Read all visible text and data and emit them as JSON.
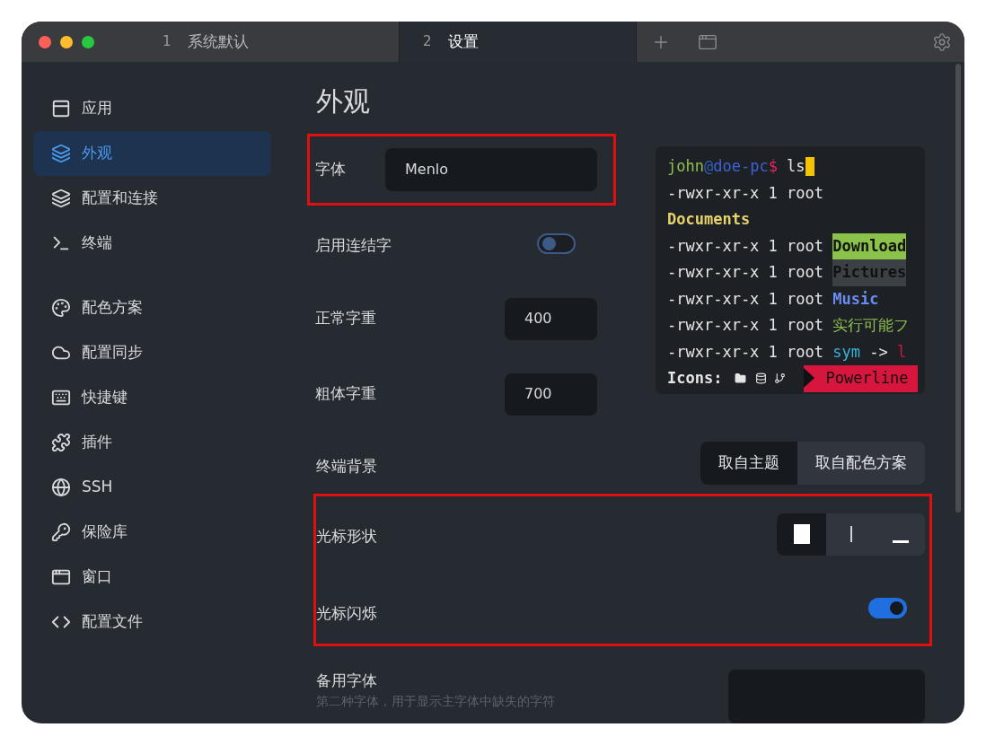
{
  "tabs": [
    {
      "number": "1",
      "label": "系统默认",
      "selected": false
    },
    {
      "number": "2",
      "label": "设置",
      "selected": true
    }
  ],
  "sidebar": {
    "items": [
      {
        "label": "应用",
        "selected": false,
        "kind": "app"
      },
      {
        "label": "外观",
        "selected": true,
        "kind": "appearance"
      },
      {
        "label": "配置和连接",
        "selected": false,
        "kind": "profiles"
      },
      {
        "label": "终端",
        "selected": false,
        "kind": "terminal"
      },
      {
        "label": "配色方案",
        "selected": false,
        "kind": "colors"
      },
      {
        "label": "配置同步",
        "selected": false,
        "kind": "sync"
      },
      {
        "label": "快捷键",
        "selected": false,
        "kind": "hotkeys"
      },
      {
        "label": "插件",
        "selected": false,
        "kind": "plugins"
      },
      {
        "label": "SSH",
        "selected": false,
        "kind": "ssh"
      },
      {
        "label": "保险库",
        "selected": false,
        "kind": "vault"
      },
      {
        "label": "窗口",
        "selected": false,
        "kind": "window"
      },
      {
        "label": "配置文件",
        "selected": false,
        "kind": "config"
      }
    ]
  },
  "page_title": "外观",
  "font": {
    "label": "字体",
    "value": "Menlo",
    "highlighted": true
  },
  "ligatures": {
    "label": "启用连结字",
    "on": false
  },
  "normal_weight": {
    "label": "正常字重",
    "value": "400"
  },
  "bold_weight": {
    "label": "粗体字重",
    "value": "700"
  },
  "terminal_preview": {
    "lines": [
      [
        {
          "text": "john",
          "kind": "user"
        },
        {
          "text": "@",
          "kind": "at"
        },
        {
          "text": "doe-pc",
          "kind": "host"
        },
        {
          "text": "$",
          "kind": "prompt"
        },
        {
          "text": " ls",
          "kind": "plain"
        }
      ],
      [
        {
          "text": "-rwxr-xr-x 1 root",
          "kind": "plain"
        }
      ],
      [
        {
          "text": "Documents",
          "kind": "directory"
        }
      ],
      [
        {
          "text": "-rwxr-xr-x 1 root ",
          "kind": "plain"
        },
        {
          "text": "Download",
          "kind": "sticky"
        }
      ],
      [
        {
          "text": "-rwxr-xr-x 1 root ",
          "kind": "plain"
        },
        {
          "text": "Pictures",
          "kind": "other_writable"
        }
      ],
      [
        {
          "text": "-rwxr-xr-x 1 root ",
          "kind": "plain"
        },
        {
          "text": "Music",
          "kind": "media"
        }
      ],
      [
        {
          "text": "-rwxr-xr-x 1 root ",
          "kind": "plain"
        },
        {
          "text": "实行可能フ",
          "kind": "executable"
        }
      ],
      [
        {
          "text": "-rwxr-xr-x 1 root ",
          "kind": "plain"
        },
        {
          "text": "sym",
          "kind": "symlink"
        },
        {
          "text": " -> ",
          "kind": "plain"
        },
        {
          "text": "l",
          "kind": "broken"
        }
      ]
    ],
    "icons_label": "Icons:",
    "powerline": "Powerline"
  },
  "terminal_background": {
    "label": "终端背景",
    "options": [
      {
        "label": "取自主题",
        "selected": true
      },
      {
        "label": "取自配色方案",
        "selected": false
      }
    ]
  },
  "cursor_shape": {
    "label": "光标形状",
    "highlighted": true,
    "options": [
      {
        "kind": "block",
        "selected": true
      },
      {
        "kind": "beam",
        "selected": false
      },
      {
        "kind": "underline",
        "selected": false
      }
    ]
  },
  "cursor_blink": {
    "label": "光标闪烁",
    "on": true
  },
  "fallback_font": {
    "label": "备用字体",
    "description": "第二种字体，用于显示主字体中缺失的字符"
  }
}
